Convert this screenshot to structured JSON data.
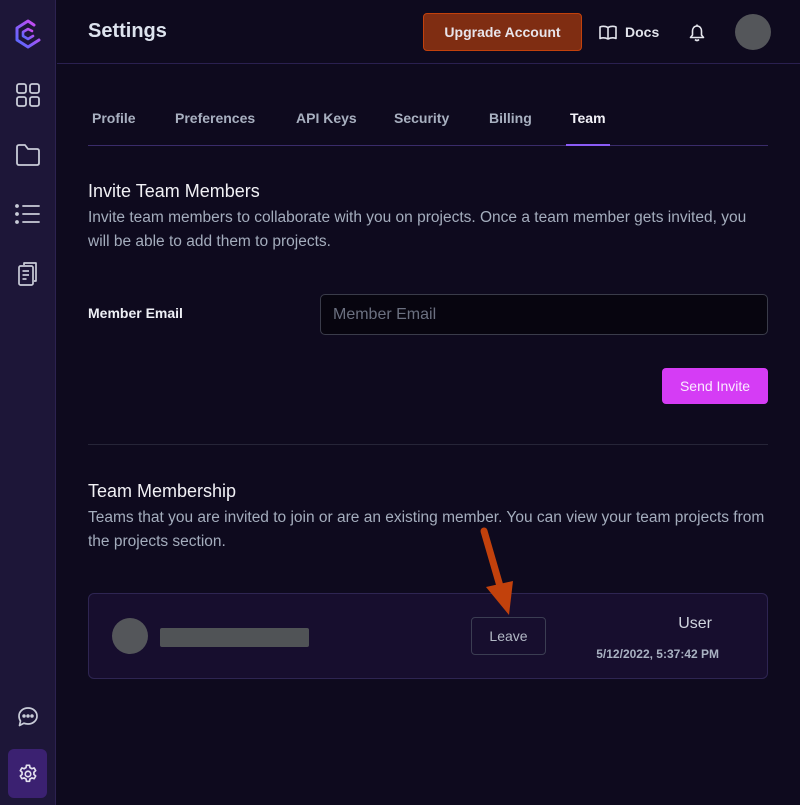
{
  "app": {
    "page_title": "Settings"
  },
  "sidebar": {
    "items": [
      {
        "name": "logo",
        "icon": "logo-icon"
      },
      {
        "name": "dashboard",
        "icon": "grid-icon"
      },
      {
        "name": "projects",
        "icon": "folder-icon"
      },
      {
        "name": "list",
        "icon": "list-icon"
      },
      {
        "name": "documents",
        "icon": "documents-icon"
      },
      {
        "name": "chat",
        "icon": "chat-icon"
      },
      {
        "name": "settings",
        "icon": "gear-icon",
        "active": true
      }
    ]
  },
  "header": {
    "upgrade_label": "Upgrade Account",
    "docs_label": "Docs",
    "notification_icon": "bell-icon"
  },
  "tabs": [
    {
      "label": "Profile"
    },
    {
      "label": "Preferences"
    },
    {
      "label": "API Keys"
    },
    {
      "label": "Security"
    },
    {
      "label": "Billing"
    },
    {
      "label": "Team",
      "active": true
    }
  ],
  "invite": {
    "title": "Invite Team Members",
    "description": "Invite team members to collaborate with you on projects. Once a team member gets invited, you will be able to add them to projects.",
    "email_label": "Member Email",
    "email_placeholder": "Member Email",
    "email_value": "",
    "send_label": "Send Invite"
  },
  "membership": {
    "title": "Team Membership",
    "description": "Teams that you are invited to join or are an existing member. You can view your team projects from the projects section.",
    "members": [
      {
        "name": "[redacted]",
        "leave_label": "Leave",
        "role": "User",
        "date": "5/12/2022, 5:37:42 PM"
      }
    ]
  },
  "colors": {
    "background": "#0e0a1e",
    "sidebar": "#1d1638",
    "upgrade": "#7f2d12",
    "send_invite": "#d53cf5",
    "tab_active_underline": "#8b5cf6",
    "annotation_arrow": "#c2410c"
  }
}
